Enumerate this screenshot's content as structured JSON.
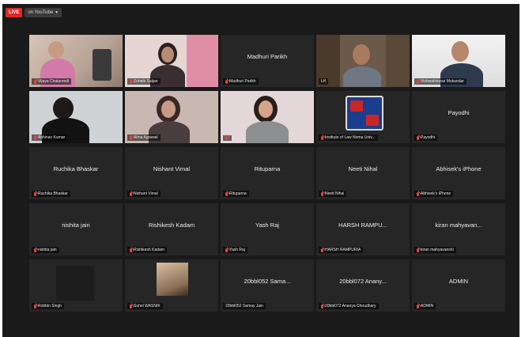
{
  "topbar": {
    "live": "LIVE",
    "stream": "on YouTube"
  },
  "tiles": [
    {
      "id": "t1",
      "center": "",
      "label": "Vijaya Chaturvedi",
      "video": true
    },
    {
      "id": "t2",
      "center": "",
      "label": "Zoheib Saijan",
      "video": true
    },
    {
      "id": "t3",
      "center": "Madhuri Parikh",
      "label": "Madhuri Parikh",
      "video": false
    },
    {
      "id": "t4",
      "center": "",
      "label": "LH",
      "video": true
    },
    {
      "id": "t5",
      "center": "",
      "label": "Vishwabiswas Mukandar",
      "video": true
    },
    {
      "id": "t6",
      "center": "",
      "label": "Abhinav Kumar",
      "video": true
    },
    {
      "id": "t7",
      "center": "",
      "label": "Alma Agrawal",
      "video": true
    },
    {
      "id": "t8",
      "center": "",
      "label": "",
      "video": true
    },
    {
      "id": "t9",
      "center": "",
      "label": "Institute of Law Nirma Univ...",
      "video": true
    },
    {
      "id": "t10",
      "center": "Payodhi",
      "label": "Payodhi",
      "video": false
    },
    {
      "id": "t11",
      "center": "Ruchika Bhaskar",
      "label": "Ruchika Bhaskar",
      "video": false
    },
    {
      "id": "t12",
      "center": "Nishant Vimal",
      "label": "Nishant Vimal",
      "video": false
    },
    {
      "id": "t13",
      "center": "Rituparna",
      "label": "Rituparna",
      "video": false
    },
    {
      "id": "t14",
      "center": "Neeti Nihal",
      "label": "Neeti Nihal",
      "video": false
    },
    {
      "id": "t15",
      "center": "Abhisek's iPhone",
      "label": "Abhisek's iPhone",
      "video": false
    },
    {
      "id": "t16",
      "center": "nishita jain",
      "label": "nishita jain",
      "video": false
    },
    {
      "id": "t17",
      "center": "Rishikesh Kadam",
      "label": "Rishikesh Kadam",
      "video": false
    },
    {
      "id": "t18",
      "center": "Yash Raj",
      "label": "Yash Raj",
      "video": false
    },
    {
      "id": "t19",
      "center": "HARSH RAMPU...",
      "label": "HARSH RAMPURIA",
      "video": false
    },
    {
      "id": "t20",
      "center": "kiran mahyavan...",
      "label": "kiran mahyavanshi",
      "video": false
    },
    {
      "id": "t21",
      "center": "",
      "label": "Robbin Singh",
      "video": true
    },
    {
      "id": "t22",
      "center": "",
      "label": "Sohel WASNIK",
      "video": true
    },
    {
      "id": "t23",
      "center": "20bbl052 Sama...",
      "label": "20bbl052 Samay Jain",
      "video": false
    },
    {
      "id": "t24",
      "center": "20bbl072 Anany...",
      "label": "20bbl072 Ananya Choudhary",
      "video": false
    },
    {
      "id": "t25",
      "center": "ADMIN",
      "label": "ADMIN",
      "video": false
    }
  ]
}
